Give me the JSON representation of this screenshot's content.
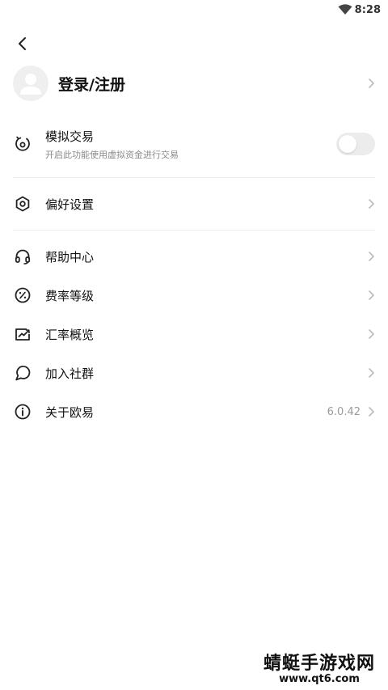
{
  "status_bar": {
    "time": "8:28"
  },
  "user": {
    "title": "登录/注册"
  },
  "simulated_trading": {
    "title": "模拟交易",
    "subtitle": "开启此功能使用虚拟资金进行交易",
    "enabled": false
  },
  "menu": {
    "preferences": "偏好设置",
    "help_center": "帮助中心",
    "fee_level": "费率等级",
    "exchange_rates": "汇率概览",
    "join_community": "加入社群",
    "about": "关于欧易",
    "version": "6.0.42"
  },
  "watermark": {
    "title": "蜻蜓手游戏网",
    "url": "www.qt6.com"
  }
}
